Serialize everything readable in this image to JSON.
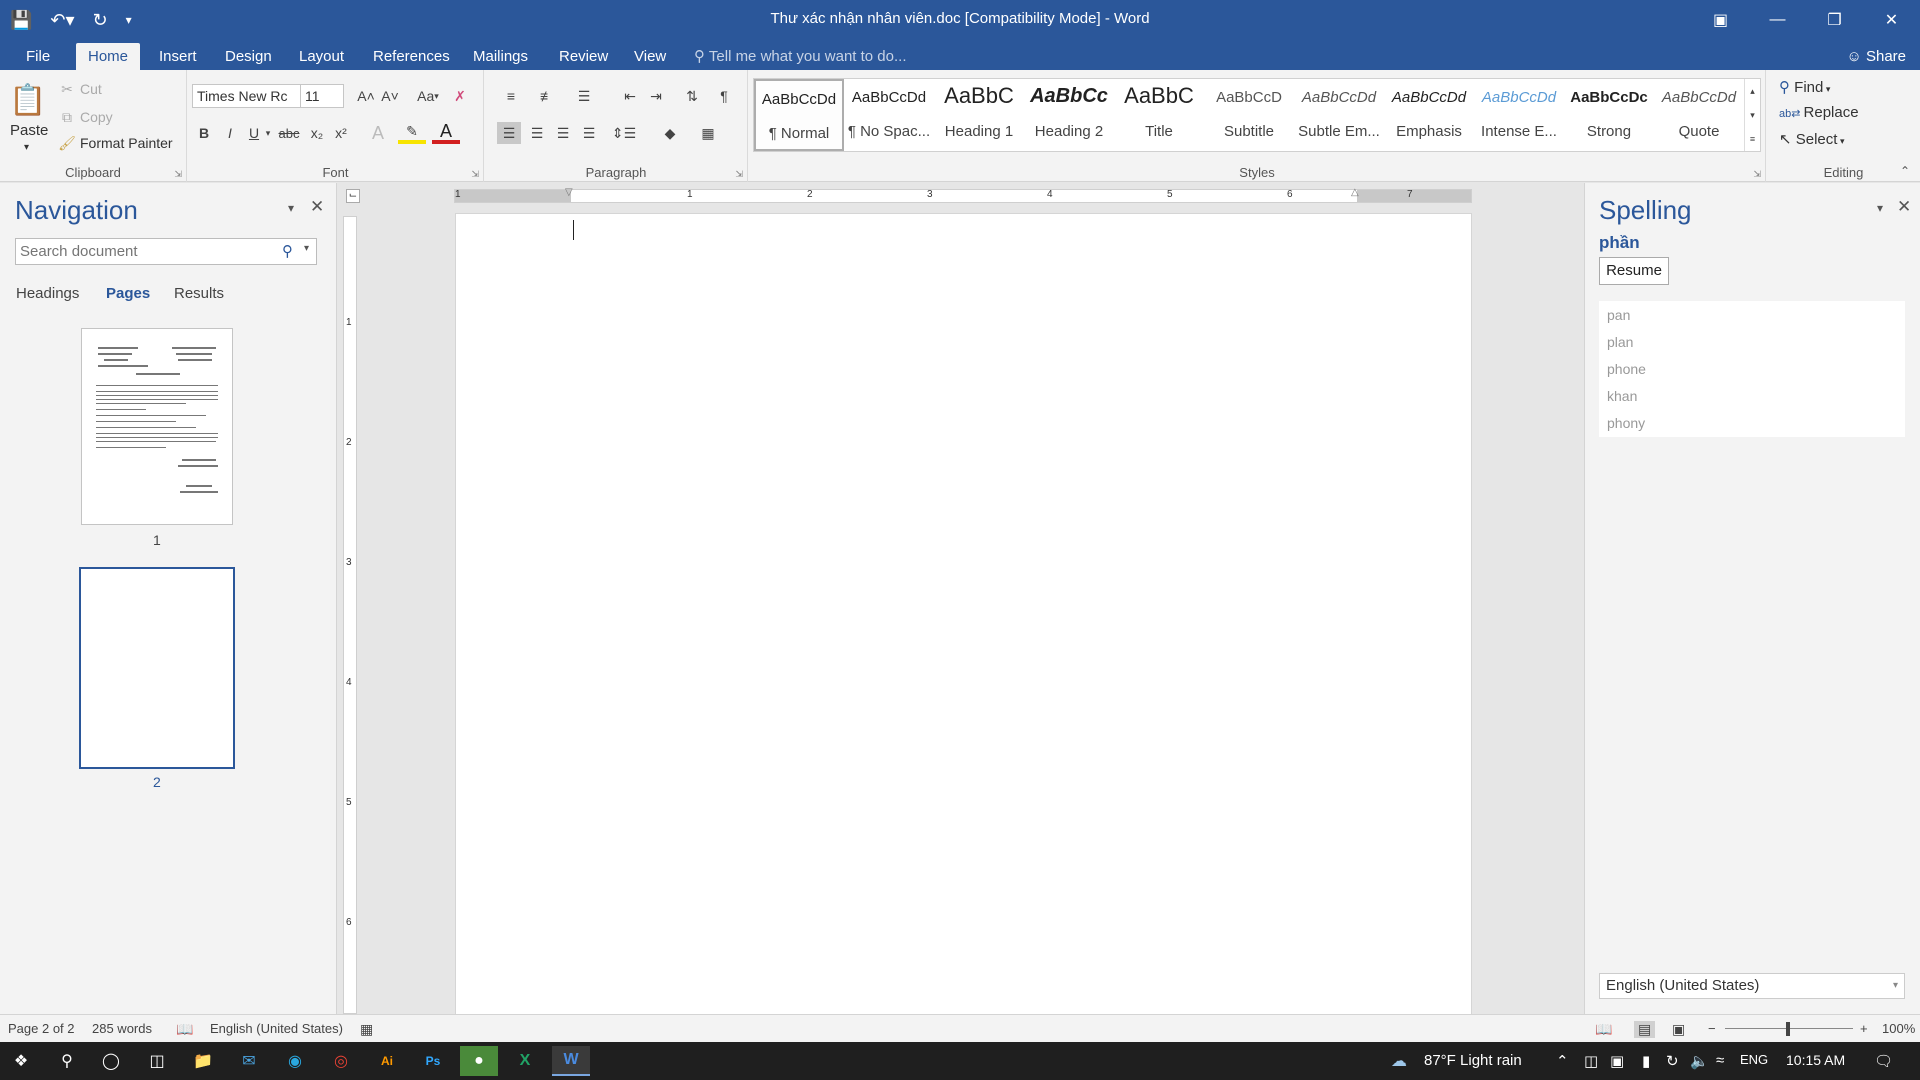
{
  "window": {
    "title": "Thư xác nhận nhân viên.doc [Compatibility Mode] - Word",
    "share_label": "Share"
  },
  "tabs": [
    "File",
    "Home",
    "Insert",
    "Design",
    "Layout",
    "References",
    "Mailings",
    "Review",
    "View"
  ],
  "tell_me": "Tell me what you want to do...",
  "clipboard": {
    "paste": "Paste",
    "cut": "Cut",
    "copy": "Copy",
    "format_painter": "Format Painter",
    "label": "Clipboard"
  },
  "font": {
    "name": "Times New Rc",
    "size": "11",
    "label": "Font",
    "case_label": "Aa",
    "bold": "B",
    "italic": "I",
    "underline": "U",
    "strike": "abc",
    "subscript": "x₂",
    "superscript": "x²",
    "grow": "A˄",
    "shrink": "A˅"
  },
  "paragraph": {
    "label": "Paragraph"
  },
  "styles": {
    "label": "Styles",
    "items": [
      {
        "preview": "AaBbCcDd",
        "name": "¶ Normal"
      },
      {
        "preview": "AaBbCcDd",
        "name": "¶ No Spac..."
      },
      {
        "preview": "AaBbC",
        "name": "Heading 1"
      },
      {
        "preview": "AaBbCc",
        "name": "Heading 2"
      },
      {
        "preview": "AaBbC",
        "name": "Title"
      },
      {
        "preview": "AaBbCcD",
        "name": "Subtitle"
      },
      {
        "preview": "AaBbCcDd",
        "name": "Subtle Em..."
      },
      {
        "preview": "AaBbCcDd",
        "name": "Emphasis"
      },
      {
        "preview": "AaBbCcDd",
        "name": "Intense E..."
      },
      {
        "preview": "AaBbCcDc",
        "name": "Strong"
      },
      {
        "preview": "AaBbCcDd",
        "name": "Quote"
      }
    ]
  },
  "editing": {
    "find": "Find",
    "replace": "Replace",
    "select": "Select",
    "label": "Editing"
  },
  "navigation": {
    "title": "Navigation",
    "search_placeholder": "Search document",
    "tabs": [
      "Headings",
      "Pages",
      "Results"
    ],
    "page_numbers": [
      "1",
      "2"
    ]
  },
  "ruler": {
    "h_numbers": [
      "1",
      "1",
      "2",
      "3",
      "4",
      "5",
      "6",
      "7"
    ],
    "v_numbers": [
      "1",
      "2",
      "3",
      "4",
      "5",
      "6"
    ]
  },
  "spelling": {
    "title": "Spelling",
    "word": "phần",
    "resume": "Resume",
    "suggestions": [
      "pan",
      "plan",
      "phone",
      "khan",
      "phony"
    ],
    "language": "English (United States)"
  },
  "status": {
    "page": "Page 2 of 2",
    "words": "285 words",
    "language": "English (United States)",
    "zoom": "100%"
  },
  "taskbar": {
    "weather": "87°F  Light rain",
    "lang": "ENG",
    "time": "10:15 AM"
  },
  "colors": {
    "accent": "#2b579a",
    "ribbon_bg": "#f3f3f3",
    "doc_bg": "#e6e6e6"
  }
}
